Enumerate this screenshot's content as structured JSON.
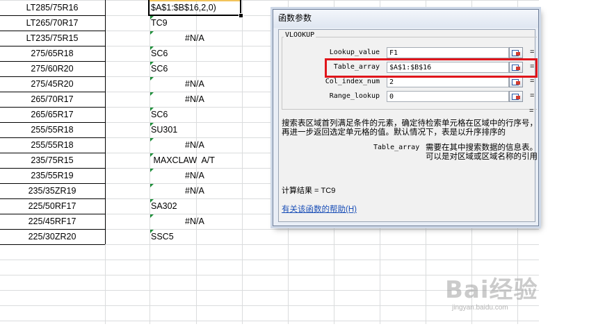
{
  "sheet": {
    "col_a": [
      "LT285/75R16",
      "LT265/70R17",
      "LT235/75R15",
      "275/65R18",
      "275/60R20",
      "275/45R20",
      "265/70R17",
      "265/65R17",
      "255/55R18",
      "255/55R18",
      "235/75R15",
      "235/55R19",
      "235/35ZR19",
      "225/50RF17",
      "225/45RF17",
      "225/30ZR20"
    ],
    "col_b": [
      "$A$1:$B$16,2,0)",
      "TC9",
      "#N/A",
      "SC6",
      "SC6",
      "#N/A",
      "#N/A",
      "SC6",
      "SU301",
      "#N/A",
      " MAXCLAW  A/T",
      "#N/A",
      "#N/A",
      "SA302",
      "#N/A",
      "SSC5"
    ]
  },
  "dialog": {
    "title": "函数参数",
    "function_name": "VLOOKUP",
    "args": [
      {
        "label": "Lookup_value",
        "value": "F1",
        "eq": "="
      },
      {
        "label": "Table_array",
        "value": "$A$1:$B$16",
        "eq": "="
      },
      {
        "label": "Col_index_num",
        "value": "2",
        "eq": "="
      },
      {
        "label": "Range_lookup",
        "value": "0",
        "eq": "="
      }
    ],
    "eq_line": "=",
    "description": "搜索表区域首列满足条件的元素，确定待检索单元格在区域中的行序号，再进一步返回选定单元格的值。默认情况下，表是以升序排序的",
    "param_name": "Table_array",
    "param_desc": "需要在其中搜索数据的信息表。可以是对区域或区域名称的引用",
    "result": "计算结果 = TC9",
    "help": "有关该函数的帮助(H)"
  },
  "watermark": {
    "logo": "Bai经验",
    "url": "jingyan.baidu.com"
  },
  "colors": {
    "highlight": "#e0151b",
    "error_triangle": "#1e8f3a",
    "link": "#1a4fb7"
  }
}
